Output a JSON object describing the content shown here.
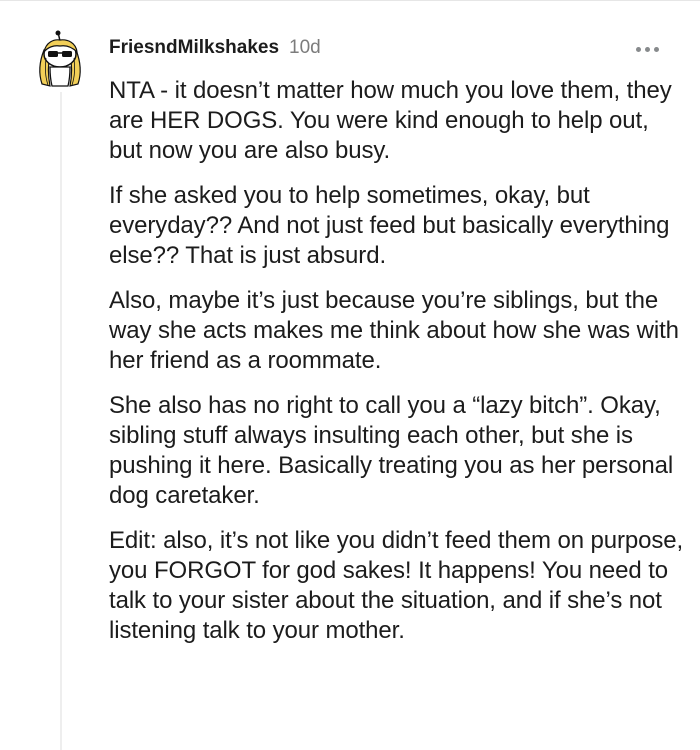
{
  "comment": {
    "author": "FriesndMilkshakes",
    "age": "10d",
    "more_icon": "more-options-icon",
    "avatar_icon": "avatar-sunglasses-icon",
    "paragraphs": [
      "NTA - it doesn’t matter how much you love them, they are HER DOGS. You were kind enough to help out, but now you are also busy.",
      "If she asked you to help sometimes, okay, but everyday?? And not just feed but basically everything else?? That is just absurd.",
      "Also, maybe it’s just because you’re siblings, but the way she acts makes me think about how she was with her friend as a roommate.",
      "She also has no right to call you a “lazy bitch”. Okay, sibling stuff always insulting each other, but she is pushing it here. Basically treating you as her personal dog caretaker.",
      "Edit: also, it’s not like you didn’t feed them on purpose, you FORGOT for god sakes! It happens! You need to talk to your sister about the situation, and if she’s not listening talk to your mother."
    ]
  },
  "colors": {
    "text": "#1c1c1c",
    "meta": "#7c7c7c",
    "icon": "#878a8c",
    "avatar_hair": "#f2cf58"
  }
}
